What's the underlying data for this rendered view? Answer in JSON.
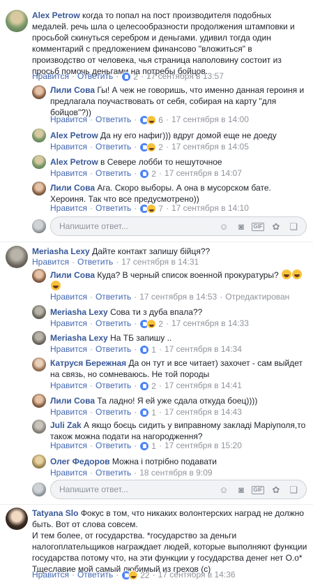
{
  "actions": {
    "like": "Нравится",
    "reply": "Ответить"
  },
  "reply_placeholder": "Напишите ответ...",
  "threads": [
    {
      "top": {
        "author": "Alex Petrow",
        "text": "когда то попал на пост производителя подобных медалей. речь шла о целесообразности продолжения штамповки и просьбой скинуться серебром и деньгами. удивил тогда один комментарий с предложением финансово \"вложиться\" в производство от человека, чья страница наполовину состоит из просьб помочь деньгами на потребы бойцов.",
        "reactions": "2",
        "time": "17 сентября в 13:57"
      },
      "replies": [
        {
          "author": "Лили Сова",
          "text": "Гы! А чеж не говоришь, что именно данная героиня и предлагала поучаствовать от себя, собирая на карту \"для бойцов\"?))",
          "reactions": "6",
          "time": "17 сентября в 14:00"
        },
        {
          "author": "Alex Petrow",
          "text": "Да ну его нафиг))) вдруг домой еще не доеду",
          "reactions": "2",
          "time": "17 сентября в 14:05"
        },
        {
          "author": "Alex Petrow",
          "text": "в Северe лобби то нешуточное",
          "reactions": "2",
          "time": "17 сентября в 14:07"
        },
        {
          "author": "Лили Сова",
          "text": "Ага. Скоро выборы. А она в мусорском бате. Хероиня. Так что все предусмотрено))",
          "reactions": "7",
          "time": "17 сентября в 14:10"
        }
      ]
    },
    {
      "top": {
        "author": "Meriasha Lexy",
        "text": "Дайте контакт запишу бійця??",
        "reactions": "",
        "time": "17 сентября в 14:31"
      },
      "replies": [
        {
          "author": "Лили Сова",
          "text": "Куда? В черный список военной прокуратуры?",
          "reactions": "",
          "time": "17 сентября в 14:53",
          "edited": "Отредактирован"
        },
        {
          "author": "Meriasha Lexy",
          "text": "Сова ти з дуба впала??",
          "reactions": "2",
          "time": "17 сентября в 14:33"
        },
        {
          "author": "Meriasha Lexy",
          "text": "На ТБ запишу ..",
          "reactions": "1",
          "time": "17 сентября в 14:34"
        },
        {
          "author": "Катруся Бережная",
          "text": "Да он тут и все читает) захочет - сам выйдет на связь, но сомневаюсь. Не той породы",
          "reactions": "2",
          "time": "17 сентября в 14:41"
        },
        {
          "author": "Лили Сова",
          "text": "Та ладно! Я ей уже сдала откуда боец))))",
          "reactions": "1",
          "time": "17 сентября в 14:43"
        },
        {
          "author": "Juli Zak",
          "text": "А якщо боєць сидить у виправному закладі Маріуполя,то також можна подати на нагородження?",
          "reactions": "1",
          "time": "17 сентября в 15:20"
        },
        {
          "author": "Олег Федоров",
          "text": "Можна і потрібно подавати",
          "reactions": "",
          "time": "18 сентября в 9:09"
        }
      ]
    },
    {
      "top": {
        "author": "Tatyana Slo",
        "text": "Фокус в том, что никаких волонтерских наград не должно быть. Вот от слова совсем.",
        "text2": "И тем более, от государства. *государство за деньги налогоплательщиков награждает людей, которые выполняют функции государства потому что, на эти функции у государства денег нет O.o*",
        "text3": "Тщеславие мой самый любимый из грехов (с)",
        "reactions": "22",
        "time": "17 сентября в 14:36"
      }
    }
  ],
  "colors": {
    "link": "#385898",
    "action": "#4267b2",
    "meta": "#90949c",
    "like": "#4d84f4",
    "haha": "#f7c23b"
  }
}
